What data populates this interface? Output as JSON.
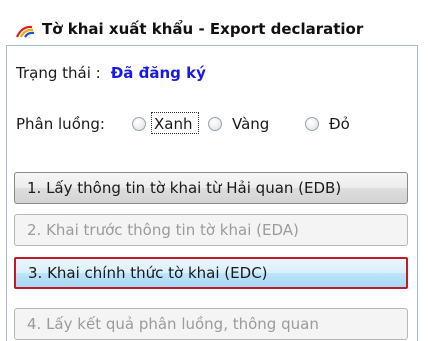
{
  "window": {
    "title": "Tờ khai xuất khẩu - Export declaratior",
    "icon": "app-logo-icon"
  },
  "status": {
    "label": "Trạng thái :",
    "value": "Đã đăng ký",
    "value_color": "#1a1ae6"
  },
  "flow": {
    "label": "Phân luồng:",
    "options": [
      {
        "label": "Xanh",
        "selected": false,
        "focused": true
      },
      {
        "label": "Vàng",
        "selected": false,
        "focused": false
      },
      {
        "label": "Đỏ",
        "selected": false,
        "focused": false
      }
    ]
  },
  "actions": [
    {
      "label": "1. Lấy thông tin tờ khai từ Hải quan (EDB)",
      "state": "enabled"
    },
    {
      "label": "2. Khai trước thông tin tờ khai (EDA)",
      "state": "disabled"
    },
    {
      "label": "3. Khai chính thức tờ khai (EDC)",
      "state": "active"
    },
    {
      "label": "4. Lấy kết quả phân luồng, thông quan",
      "state": "disabled"
    }
  ],
  "colors": {
    "active_border": "#c0192a",
    "active_fill": "#bee4f8",
    "panel_border": "#a9b8c8"
  }
}
